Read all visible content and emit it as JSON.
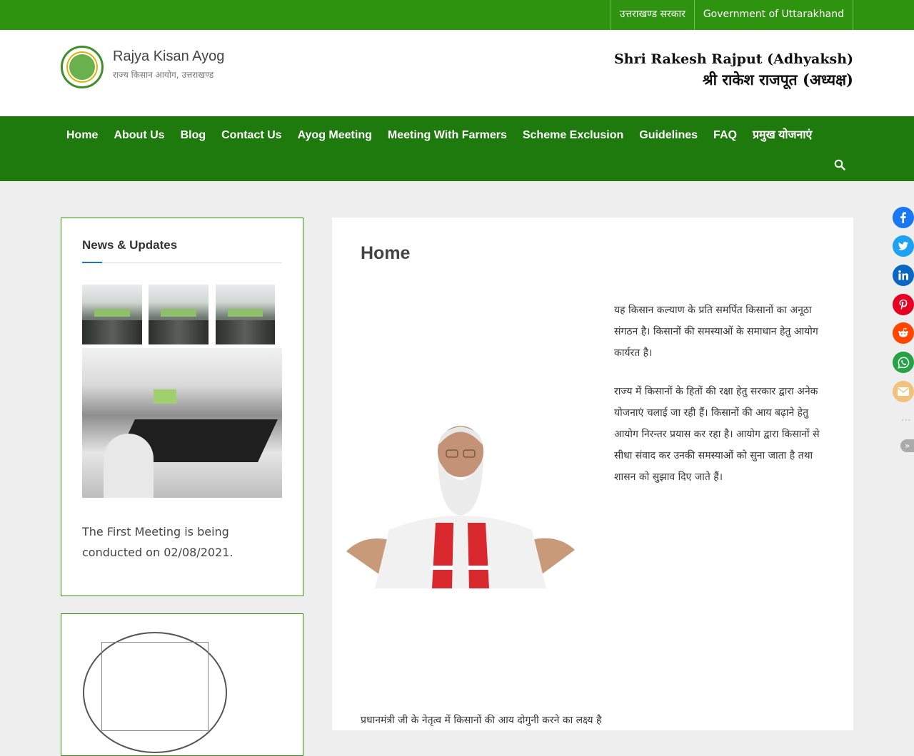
{
  "topbar": {
    "links": [
      "उत्तराखण्ड सरकार",
      "Government of Uttarakhand"
    ]
  },
  "header": {
    "site_title": "Rajya Kisan Ayog",
    "site_description": "राज्य किसान आयोग, उत्तराखण्ड",
    "chairman_en": "Shri Rakesh Rajput (Adhyaksh)",
    "chairman_hi": "श्री राकेश राजपूत (अध्यक्ष)"
  },
  "nav": {
    "items": [
      "Home",
      "About Us",
      "Blog",
      "Contact Us",
      "Ayog Meeting",
      "Meeting With Farmers",
      "Scheme Exclusion",
      "Guidelines",
      "FAQ",
      "प्रमुख योजनाएं"
    ]
  },
  "sidebar": {
    "news_title": "News & Updates",
    "news_text": "The First Meeting is being conducted on 02/08/2021."
  },
  "main": {
    "title": "Home",
    "paragraphs": [
      "यह किसान कल्याण के प्रति समर्पित किसानों का अनूठा संगठन है। किसानों की समस्याओं के समाधान हेतु आयोग कार्यरत है।",
      "राज्य में किसानों के हितों की रक्षा हेतु सरकार द्वारा अनेक योजनाएं चलाई जा रही हैं। किसानों की आय बढ़ाने हेतु आयोग निरन्तर प्रयास कर रहा है। आयोग द्वारा किसानों से सीधा संवाद कर उनकी समस्याओं को सुना जाता है तथा शासन को सुझाव दिए जाते हैं।"
    ],
    "bottom_text": "प्रधानमंत्री जी के नेतृत्व में किसानों की आय दोगुनी करने का लक्ष्य है"
  },
  "share": [
    "facebook",
    "twitter",
    "linkedin",
    "pinterest",
    "reddit",
    "whatsapp",
    "email"
  ],
  "colors": {
    "topbar": "#2e9410",
    "nav": "#1e7a0c",
    "facebook": "#1877f2",
    "twitter": "#1da1f2",
    "linkedin": "#0a66c2",
    "pinterest": "#e60023",
    "reddit": "#ff4500",
    "whatsapp": "#25a244",
    "email": "#f0c27b"
  }
}
